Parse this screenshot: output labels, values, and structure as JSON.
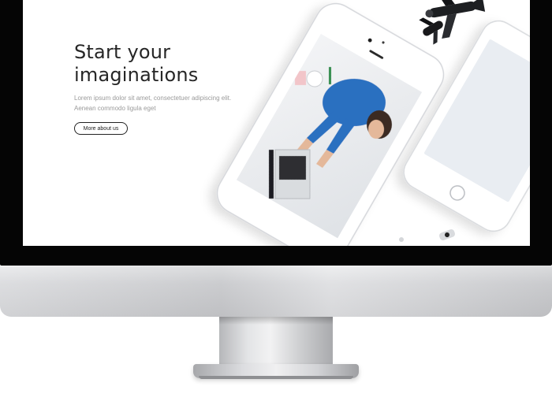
{
  "hero": {
    "title_line1": "Start your",
    "title_line2": "imaginations",
    "description": "Lorem ipsum dolor sit amet, consectetuer adipiscing elit. Aenean commodo ligula eget",
    "button_label": "More about us"
  },
  "colors": {
    "title": "#262626",
    "body_text": "#9a9a9a",
    "shirt_blue": "#2b6fc0",
    "bezel": "#050505",
    "aluminium": "#d6d7da"
  },
  "icons": [
    "airplane-icon",
    "phone-icon",
    "tablet-icon",
    "laptop-icon"
  ]
}
